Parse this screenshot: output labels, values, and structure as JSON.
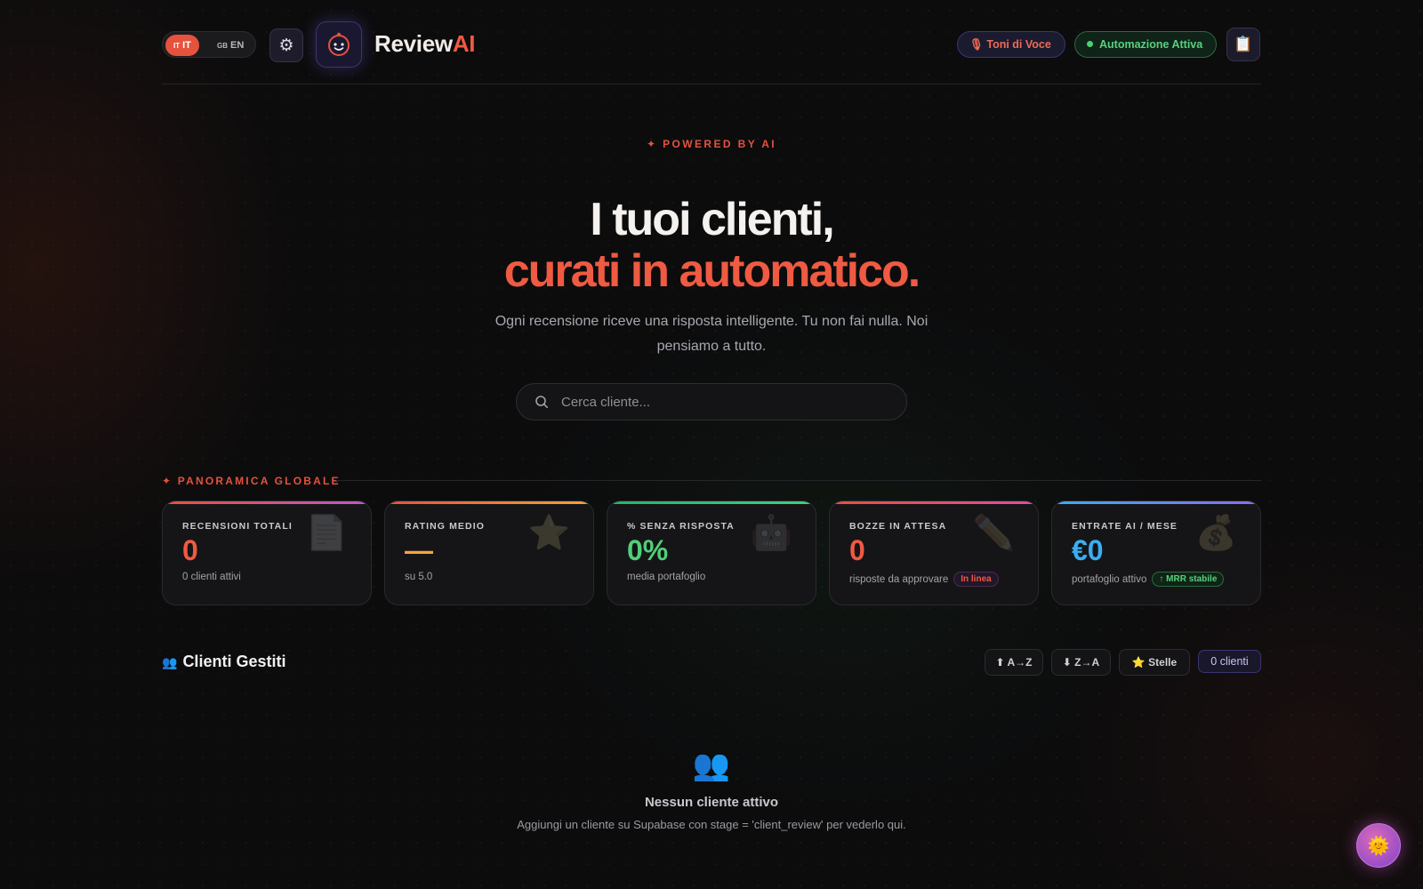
{
  "header": {
    "lang": {
      "it_flag": "IT",
      "it": "IT",
      "en_flag": "GB",
      "en": "EN"
    },
    "brand_a": "Review",
    "brand_b": "AI",
    "tone_pill": "Toni di Voce",
    "automation_pill": "Automazione Attiva"
  },
  "hero": {
    "kicker": "✦ POWERED BY AI",
    "title_line1": "I tuoi clienti,",
    "title_line2": "curati in automatico.",
    "subtitle": "Ogni recensione riceve una risposta intelligente. Tu non fai nulla. Noi pensiamo a tutto.",
    "search_placeholder": "Cerca cliente..."
  },
  "overview": {
    "title": "✦ PANORAMICA GLOBALE",
    "cards": [
      {
        "label": "RECENSIONI TOTALI",
        "value": "0",
        "note": "0 clienti attivi",
        "icon": "document-icon",
        "color": "#ef5a42",
        "bar": "linear-gradient(90deg,#e5523d,#c257c8)"
      },
      {
        "label": "RATING MEDIO",
        "value": "—",
        "note": "su 5.0",
        "icon": "star-icon",
        "color": "#f3a43b",
        "bar": "linear-gradient(90deg,#e5523d,#f3a43b)"
      },
      {
        "label": "% SENZA RISPOSTA",
        "value": "0%",
        "note": "media portafoglio",
        "icon": "robot-icon",
        "color": "#4fd07a",
        "bar": "linear-gradient(90deg,#27b36a,#3fd084)"
      },
      {
        "label": "BOZZE IN ATTESA",
        "value": "0",
        "note": "risposte da approvare",
        "tag": "In linea",
        "icon": "pencil-icon",
        "color": "#ef5a42",
        "bar": "linear-gradient(90deg,#e5523d,#e04ea0)"
      },
      {
        "label": "ENTRATE AI / MESE",
        "value": "€0",
        "note": "portafoglio attivo",
        "tag": "↑ MRR stabile",
        "icon": "money-bag-icon",
        "color": "#3aaef0",
        "bar": "linear-gradient(90deg,#3aaef0,#8b6cf0)"
      }
    ]
  },
  "clients": {
    "title": "Clienti Gestiti",
    "sort_az": "⬆ A→Z",
    "sort_za": "⬇ Z→A",
    "sort_stars": "Stelle",
    "count": "0 clienti",
    "empty_title": "Nessun cliente attivo",
    "empty_sub": "Aggiungi un cliente su Supabase con stage = 'client_review' per vederlo qui."
  }
}
